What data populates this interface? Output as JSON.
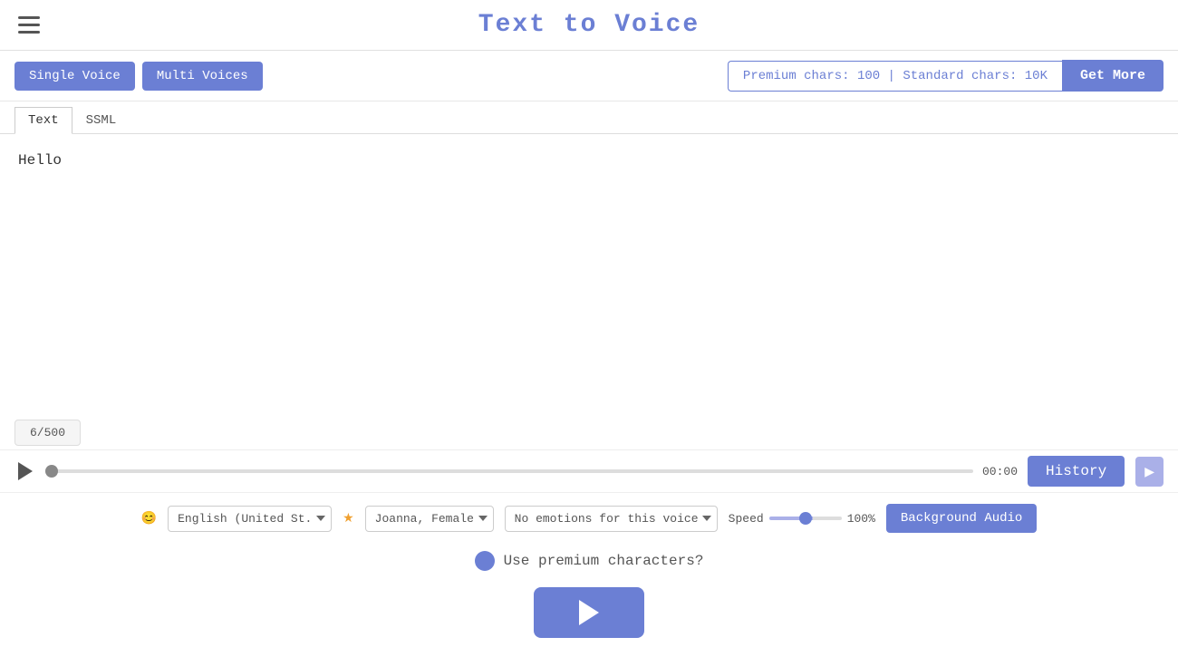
{
  "header": {
    "title": "Text to Voice",
    "menu_icon": "hamburger"
  },
  "toolbar": {
    "single_voice_label": "Single Voice",
    "multi_voices_label": "Multi Voices",
    "chars_display": "Premium chars: 100 | Standard chars: 10K",
    "get_more_label": "Get More"
  },
  "tabs": [
    {
      "id": "text",
      "label": "Text",
      "active": true
    },
    {
      "id": "ssml",
      "label": "SSML",
      "active": false
    }
  ],
  "editor": {
    "content": "Hello",
    "char_count": "6/500"
  },
  "player": {
    "time": "00:00",
    "history_label": "History",
    "seek_value": 0
  },
  "settings": {
    "language": "English (United St.",
    "voice": "Joanna, Female",
    "emotion": "No emotions for this voice",
    "speed_label": "Speed",
    "speed_value": 100,
    "speed_display": "100%",
    "background_audio_label": "Background Audio"
  },
  "premium": {
    "label": "Use premium characters?"
  },
  "play_button": {
    "label": "Play"
  }
}
